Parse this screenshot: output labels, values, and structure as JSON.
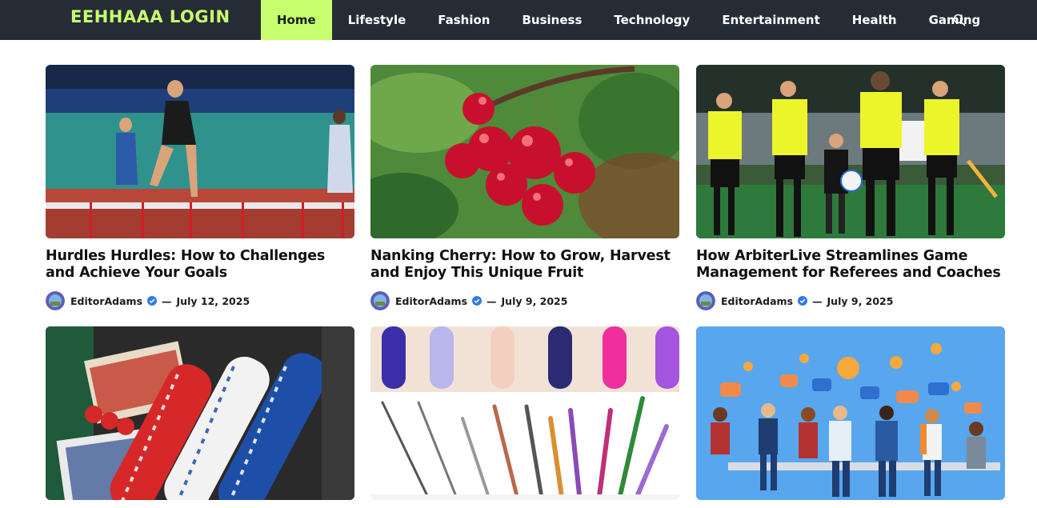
{
  "header": {
    "brand": "EEHHAAA LOGIN",
    "nav": [
      {
        "label": "Home",
        "active": true
      },
      {
        "label": "Lifestyle",
        "active": false
      },
      {
        "label": "Fashion",
        "active": false
      },
      {
        "label": "Business",
        "active": false
      },
      {
        "label": "Technology",
        "active": false
      },
      {
        "label": "Entertainment",
        "active": false
      },
      {
        "label": "Health",
        "active": false
      },
      {
        "label": "Gaming",
        "active": false
      }
    ],
    "search_icon": "search-icon"
  },
  "posts": [
    {
      "title": "Hurdles Hurdles: How to Challenges and Achieve Your Goals",
      "author": "EditorAdams",
      "separator": "—",
      "date": "July 12, 2025",
      "image": "hurdles-race-photo"
    },
    {
      "title": "Nanking Cherry: How to Grow, Harvest and Enjoy This Unique Fruit",
      "author": "EditorAdams",
      "separator": "—",
      "date": "July 9, 2025",
      "image": "cherries-photo"
    },
    {
      "title": "How ArbiterLive Streamlines Game Management for Referees and Coaches",
      "author": "EditorAdams",
      "separator": "—",
      "date": "July 9, 2025",
      "image": "referees-photo"
    },
    {
      "title": "",
      "author": "",
      "separator": "",
      "date": "",
      "image": "poker-chips-photo"
    },
    {
      "title": "",
      "author": "",
      "separator": "",
      "date": "",
      "image": "nail-art-brushes-photo"
    },
    {
      "title": "",
      "author": "",
      "separator": "",
      "date": "",
      "image": "team-meeting-illustration"
    }
  ],
  "colors": {
    "header_bg": "#262c35",
    "accent": "#c7ff6e",
    "verified": "#2f7bea"
  }
}
